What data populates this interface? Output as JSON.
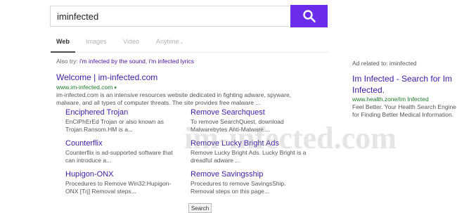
{
  "search": {
    "query": "iminfected",
    "button_icon": "magnifier-icon",
    "button_color": "#6a2ce9"
  },
  "tabs": [
    {
      "label": "Web",
      "active": true
    },
    {
      "label": "Images",
      "active": false
    },
    {
      "label": "Video",
      "active": false
    },
    {
      "label": "Anytime",
      "active": false,
      "has_dropdown": true
    }
  ],
  "also_try": {
    "prefix": "Also try:",
    "links": [
      "i'm infected by the sound",
      "i'm infected lyrics"
    ],
    "separator": ", "
  },
  "main_result": {
    "title": "Welcome | im-infected.com",
    "url": "www.im-infected.com",
    "snippet": "im-infected.com is an intensive resources website dedicated in fighting adware, spyware, malware, and all types of computer threats. The site provides free malware ..."
  },
  "sitelinks": [
    {
      "title": "Enciphered Trojan",
      "snippet": "EnCiPhErEd Trojan or also known as Trojan.Ransom.HM is a..."
    },
    {
      "title": "Remove Searchquest",
      "snippet": "To remove SearchQuest, download Malwarebytes Anti-Malware...."
    },
    {
      "title": "Counterflix",
      "snippet": "Counterflix is ad-supported software that can introduce a..."
    },
    {
      "title": "Remove Lucky Bright Ads",
      "snippet": "Remove Lucky Bright Ads. Lucky Bright is a dreadful adware ..."
    },
    {
      "title": "Hupigon-ONX",
      "snippet": "Procedures to Remove Win32:Hupigon-ONX [Trj] Removal steps..."
    },
    {
      "title": "Remove Savingsship",
      "snippet": "Procedures to remove SavingsShip. Removal steps on this page..."
    }
  ],
  "bottom_button": "Search",
  "ad": {
    "label": "Ad related to: iminfected",
    "title": "Im Infected - Search for Im Infected.",
    "url": "www.health.zone/Im Infected",
    "description": "Feel Better. Your Health Search Engine for Finding Better Medical Information."
  },
  "watermark": "im-infected.com",
  "colors": {
    "link": "#3c1ba4",
    "url": "#1f7a2b",
    "accent": "#6a2ce9"
  }
}
